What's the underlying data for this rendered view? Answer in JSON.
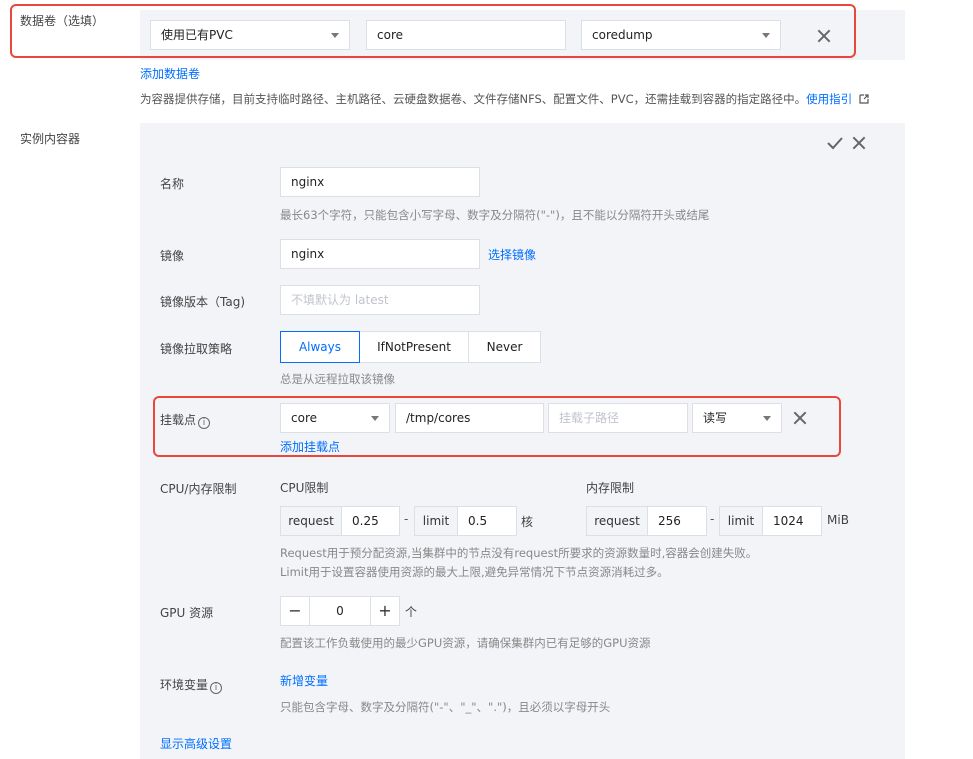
{
  "volume": {
    "label": "数据卷（选填）",
    "type_select": "使用已有PVC",
    "name_value": "core",
    "pvc_select": "coredump",
    "add_link": "添加数据卷",
    "hint": "为容器提供存储，目前支持临时路径、主机路径、云硬盘数据卷、文件存储NFS、配置文件、PVC，还需挂载到容器的指定路径中。",
    "guide_link": "使用指引"
  },
  "container": {
    "section_label": "实例内容器",
    "name_label": "名称",
    "name_value": "nginx",
    "name_hint": "最长63个字符，只能包含小写字母、数字及分隔符(\"-\")，且不能以分隔符开头或结尾",
    "image_label": "镜像",
    "image_value": "nginx",
    "image_select_link": "选择镜像",
    "tag_label": "镜像版本（Tag)",
    "tag_placeholder": "不填默认为 latest",
    "pull_label": "镜像拉取策略",
    "pull_options": [
      "Always",
      "IfNotPresent",
      "Never"
    ],
    "pull_selected": "Always",
    "pull_hint": "总是从远程拉取该镜像",
    "mount_label": "挂载点",
    "mount_volume": "core",
    "mount_path": "/tmp/cores",
    "mount_subpath_placeholder": "挂载子路径",
    "mount_mode": "读写",
    "mount_add_link": "添加挂载点",
    "resource_label": "CPU/内存限制",
    "cpu_title": "CPU限制",
    "cpu_request_label": "request",
    "cpu_request": "0.25",
    "cpu_limit_label": "limit",
    "cpu_limit": "0.5",
    "cpu_unit": "核",
    "mem_title": "内存限制",
    "mem_request_label": "request",
    "mem_request": "256",
    "mem_limit_label": "limit",
    "mem_limit": "1024",
    "mem_unit": "MiB",
    "resource_hint_1": "Request用于预分配资源,当集群中的节点没有request所要求的资源数量时,容器会创建失败。",
    "resource_hint_2": "Limit用于设置容器使用资源的最大上限,避免异常情况下节点资源消耗过多。",
    "gpu_label": "GPU 资源",
    "gpu_value": "0",
    "gpu_unit": "个",
    "gpu_hint": "配置该工作负载使用的最少GPU资源，请确保集群内已有足够的GPU资源",
    "env_label": "环境变量",
    "env_add_link": "新增变量",
    "env_hint": "只能包含字母、数字及分隔符(\"-\"、\"_\"、\".\")，且必须以字母开头",
    "advanced_link": "显示高级设置"
  },
  "colors": {
    "accent": "#006eff",
    "highlight": "#e8483b",
    "panel": "#f3f4f7"
  }
}
